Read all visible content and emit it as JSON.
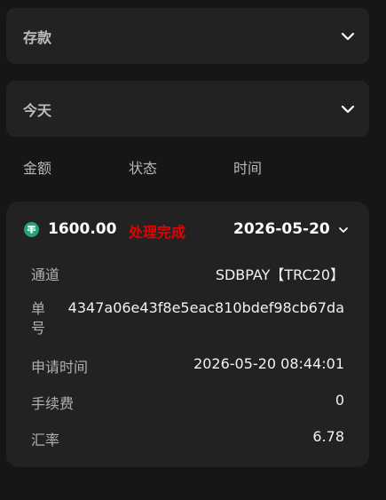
{
  "filters": {
    "type_select": {
      "label": "存款"
    },
    "date_select": {
      "label": "今天"
    }
  },
  "columns": {
    "amount": "金额",
    "status": "状态",
    "time": "时间"
  },
  "record": {
    "coin_icon": "tether-usdt-icon",
    "amount": "1600.00",
    "status": "处理完成",
    "status_color": "#e60000",
    "date": "2026-05-20",
    "details": {
      "channel_label": "通道",
      "channel_value": "SDBPAY【TRC20】",
      "order_label": "单号",
      "order_value": "4347a06e43f8e5eac810bdef98cb67da",
      "apply_time_label": "申请时间",
      "apply_time_value": "2026-05-20 08:44:01",
      "fee_label": "手续费",
      "fee_value": "0",
      "rate_label": "汇率",
      "rate_value": "6.78"
    }
  },
  "colors": {
    "background": "#161616",
    "card": "#222222",
    "accent_green": "#26a17b"
  }
}
